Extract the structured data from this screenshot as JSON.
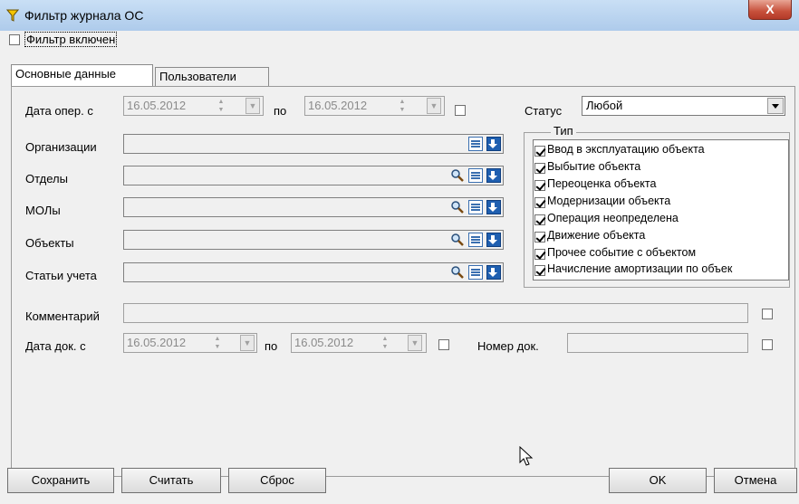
{
  "window": {
    "title": "Фильтр журнала ОС",
    "close_label": "X"
  },
  "filter_enabled": {
    "label": "Фильтр включен",
    "checked": false
  },
  "tabs": [
    {
      "label": "Основные данные",
      "active": true
    },
    {
      "label": "Пользователи",
      "active": false
    }
  ],
  "oper_date": {
    "label": "Дата опер. с",
    "from": "16.05.2012",
    "to_label": "по",
    "to": "16.05.2012",
    "checked": false
  },
  "status": {
    "label": "Статус",
    "value": "Любой"
  },
  "fields": [
    {
      "label": "Организации",
      "has_search": false
    },
    {
      "label": "Отделы",
      "has_search": true
    },
    {
      "label": "МОЛы",
      "has_search": true
    },
    {
      "label": "Объекты",
      "has_search": true
    },
    {
      "label": "Статьи учета",
      "has_search": true
    }
  ],
  "type_group": {
    "title": "Тип",
    "items": [
      {
        "label": "Ввод в эксплуатацию объекта",
        "checked": true
      },
      {
        "label": "Выбытие объекта",
        "checked": true
      },
      {
        "label": "Переоценка объекта",
        "checked": true
      },
      {
        "label": "Модернизации объекта",
        "checked": true
      },
      {
        "label": "Операция неопределена",
        "checked": true
      },
      {
        "label": "Движение объекта",
        "checked": true
      },
      {
        "label": "Прочее событие с объектом",
        "checked": true
      },
      {
        "label": "Начисление амортизации по объек",
        "checked": true
      }
    ]
  },
  "comment": {
    "label": "Комментарий",
    "value": "",
    "checked": false
  },
  "doc_date": {
    "label": "Дата док. с",
    "from": "16.05.2012",
    "to_label": "по",
    "to": "16.05.2012",
    "checked": false
  },
  "doc_number": {
    "label": "Номер док.",
    "value": "",
    "checked": false
  },
  "buttons": {
    "save": "Сохранить",
    "load": "Считать",
    "reset": "Сброс",
    "ok": "OK",
    "cancel": "Отмена"
  }
}
